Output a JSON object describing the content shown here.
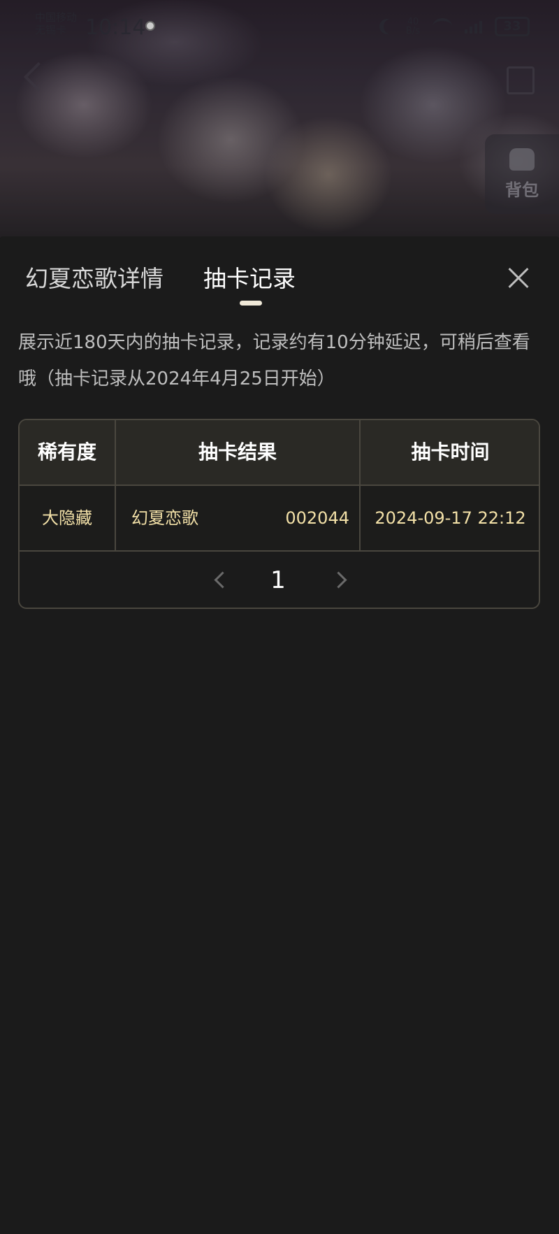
{
  "status_bar": {
    "carrier": "中国移动 无锡卡",
    "time": "10:14",
    "net_speed": "40\nB/s",
    "battery": "33"
  },
  "header": {
    "bag_label": "背包"
  },
  "sheet": {
    "tabs": [
      {
        "label": "幻夏恋歌详情",
        "active": false
      },
      {
        "label": "抽卡记录",
        "active": true
      }
    ],
    "notice": "展示近180天内的抽卡记录，记录约有10分钟延迟，可稍后查看哦（抽卡记录从2024年4月25日开始）",
    "table": {
      "headers": [
        "稀有度",
        "抽卡结果",
        "抽卡时间"
      ],
      "rows": [
        {
          "rarity": "大隐藏",
          "card_name": "幻夏恋歌",
          "card_no": "002044",
          "time": "2024-09-17 22:12"
        }
      ]
    },
    "pagination": {
      "current_page": "1"
    }
  },
  "colors": {
    "background": "#1b1b1b",
    "highlight_text": "#f3e1a8",
    "table_border": "#4a473f",
    "header_bg": "#2a2925"
  },
  "icons": [
    "back-icon",
    "share-icon",
    "bag-icon",
    "close-icon",
    "chevron-left-icon",
    "chevron-right-icon"
  ]
}
